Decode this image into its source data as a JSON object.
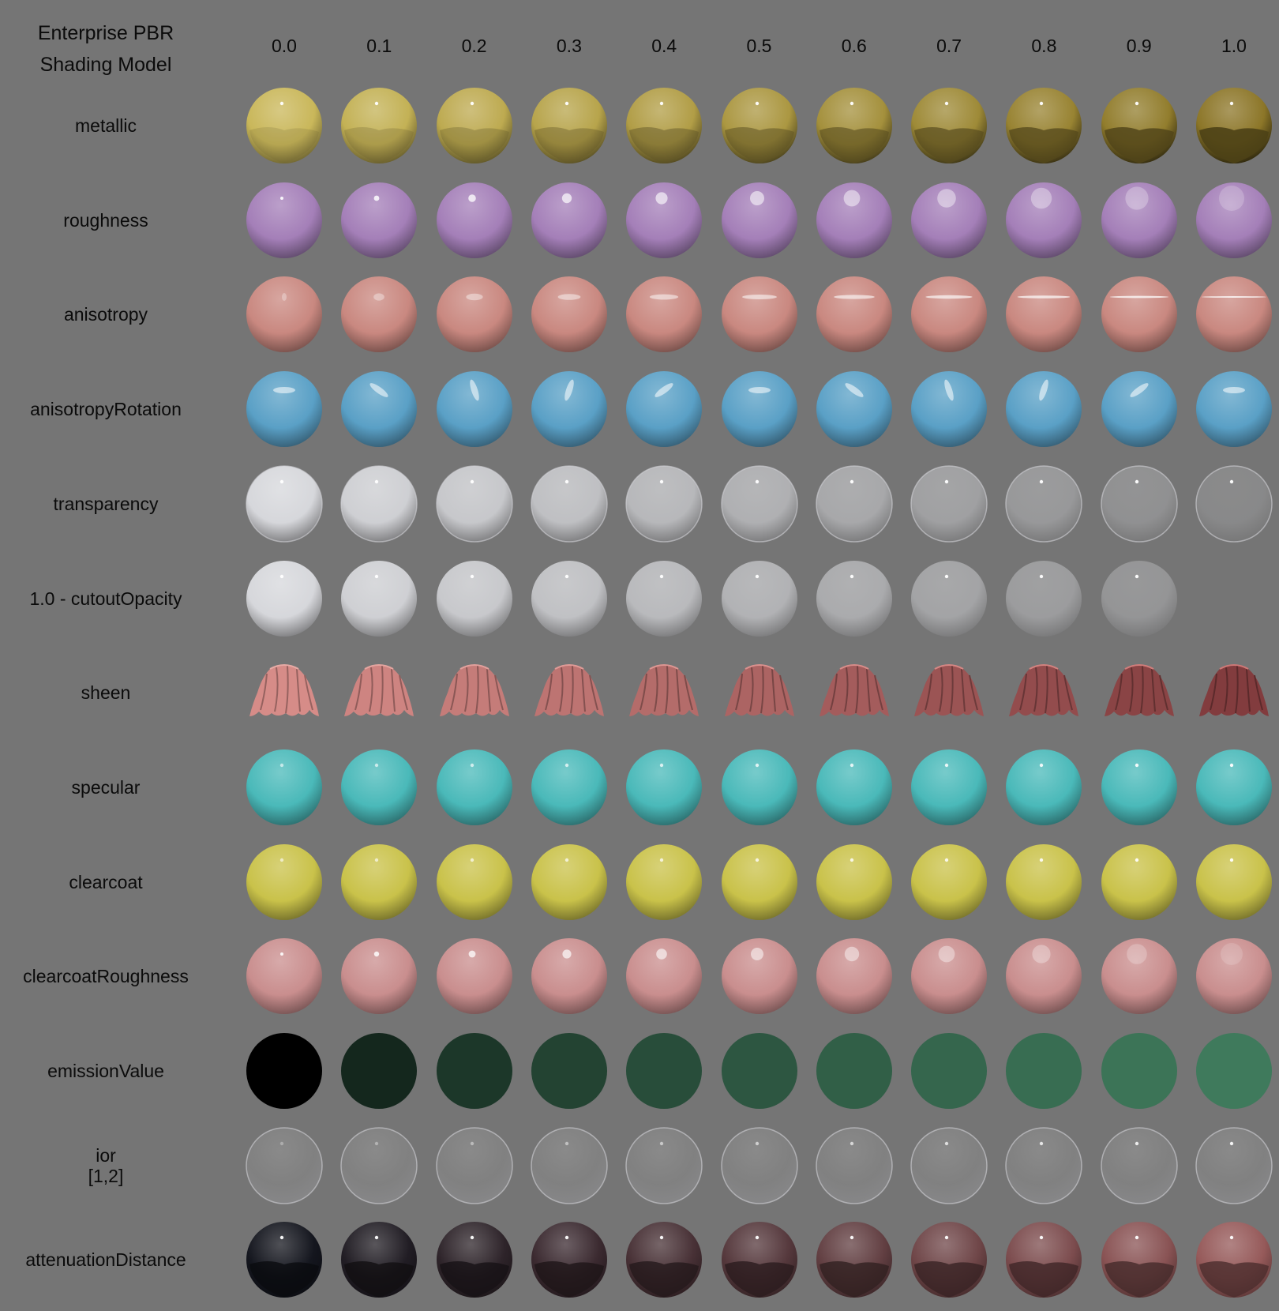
{
  "title": "Enterprise PBR\nShading Model",
  "columns": [
    "0.0",
    "0.1",
    "0.2",
    "0.3",
    "0.4",
    "0.5",
    "0.6",
    "0.7",
    "0.8",
    "0.9",
    "1.0"
  ],
  "rows": [
    {
      "label": "metallic",
      "kind": "metallic",
      "base": "#c9b75a",
      "swatches": 11
    },
    {
      "label": "roughness",
      "kind": "roughness",
      "base": "#a47fb8",
      "swatches": 11
    },
    {
      "label": "anisotropy",
      "kind": "anisotropy",
      "base": "#c98880",
      "swatches": 11
    },
    {
      "label": "anisotropyRotation",
      "kind": "aniso_rot",
      "base": "#5aa0c6",
      "swatches": 11
    },
    {
      "label": "transparency",
      "kind": "transparency",
      "base": "#d6d7db",
      "swatches": 11
    },
    {
      "label": "1.0 - cutoutOpacity",
      "kind": "cutout",
      "base": "#d6d7db",
      "swatches": 10
    },
    {
      "label": "sheen",
      "kind": "sheen",
      "base": "#b56a66",
      "swatches": 11
    },
    {
      "label": "specular",
      "kind": "specular",
      "base": "#4ab9b9",
      "swatches": 11
    },
    {
      "label": "clearcoat",
      "kind": "clearcoat",
      "base": "#c9c24a",
      "swatches": 11
    },
    {
      "label": "clearcoatRoughness",
      "kind": "cc_rough",
      "base": "#c98e8e",
      "swatches": 11
    },
    {
      "label": "emissionValue",
      "kind": "emission",
      "base": "#3f7a5c",
      "swatches": 11
    },
    {
      "label": "ior\n[1,2]",
      "kind": "ior",
      "base": "#8a8a8a",
      "swatches": 11
    },
    {
      "label": "attenuationDistance",
      "kind": "attenuation",
      "base": "#8a2a2a",
      "swatches": 11
    }
  ]
}
